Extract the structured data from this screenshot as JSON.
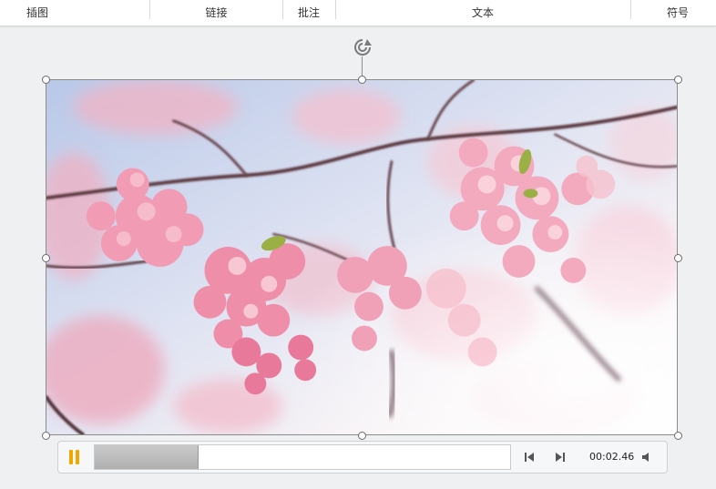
{
  "ribbon": {
    "groups": [
      {
        "label": "插图"
      },
      {
        "label": "链接"
      },
      {
        "label": "批注"
      },
      {
        "label": "文本"
      },
      {
        "label": "符号"
      }
    ]
  },
  "playback": {
    "time": "00:02.46",
    "progress_fraction": 0.25,
    "state": "playing"
  },
  "media": {
    "subject": "cherry-blossom-photo"
  },
  "colors": {
    "pause_icon": "#f2a600",
    "frame": "#8c8c8c",
    "background": "#eef0f1"
  }
}
